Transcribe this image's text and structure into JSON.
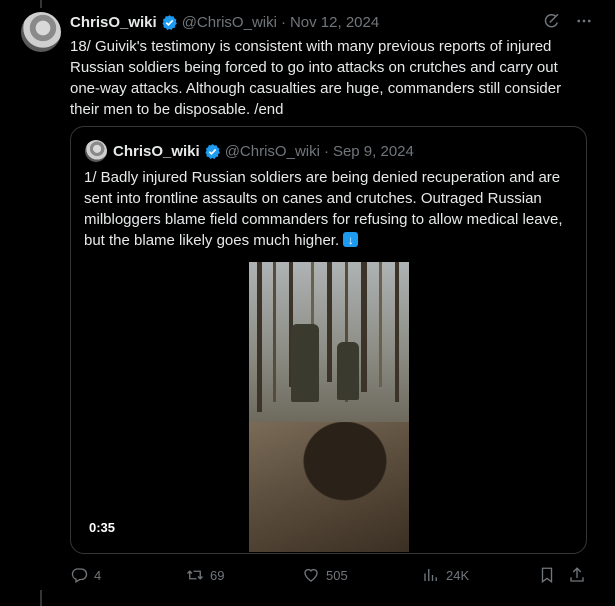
{
  "tweet": {
    "author_name": "ChrisO_wiki",
    "author_handle": "@ChrisO_wiki",
    "separator": "·",
    "date": "Nov 12, 2024",
    "text": "18/ Guivik's testimony is consistent with many previous reports of injured Russian soldiers being forced to go into attacks on crutches and carry out one-way attacks. Although casualties are huge, commanders still consider their men to be disposable. /end"
  },
  "quoted_tweet": {
    "author_name": "ChrisO_wiki",
    "author_handle": "@ChrisO_wiki",
    "separator": "·",
    "date": "Sep 9, 2024",
    "text": "1/ Badly injured Russian soldiers are being denied recuperation and are sent into frontline assaults on canes and crutches. Outraged Russian milbloggers blame field commanders for refusing to allow medical leave, but the blame likely goes much higher.",
    "video_duration": "0:35"
  },
  "actions": {
    "replies": "4",
    "reposts": "69",
    "likes": "505",
    "views": "24K"
  },
  "icons": {
    "verified": "verified-badge-icon",
    "grok": "grok-icon",
    "more": "more-icon",
    "reply": "reply-icon",
    "repost": "repost-icon",
    "like": "like-icon",
    "views": "views-icon",
    "bookmark": "bookmark-icon",
    "share": "share-icon",
    "emoji": "down-arrow-emoji"
  },
  "colors": {
    "background": "#000000",
    "text": "#e7e9ea",
    "muted": "#71767b",
    "accent": "#1d9bf0",
    "border": "#333639"
  }
}
